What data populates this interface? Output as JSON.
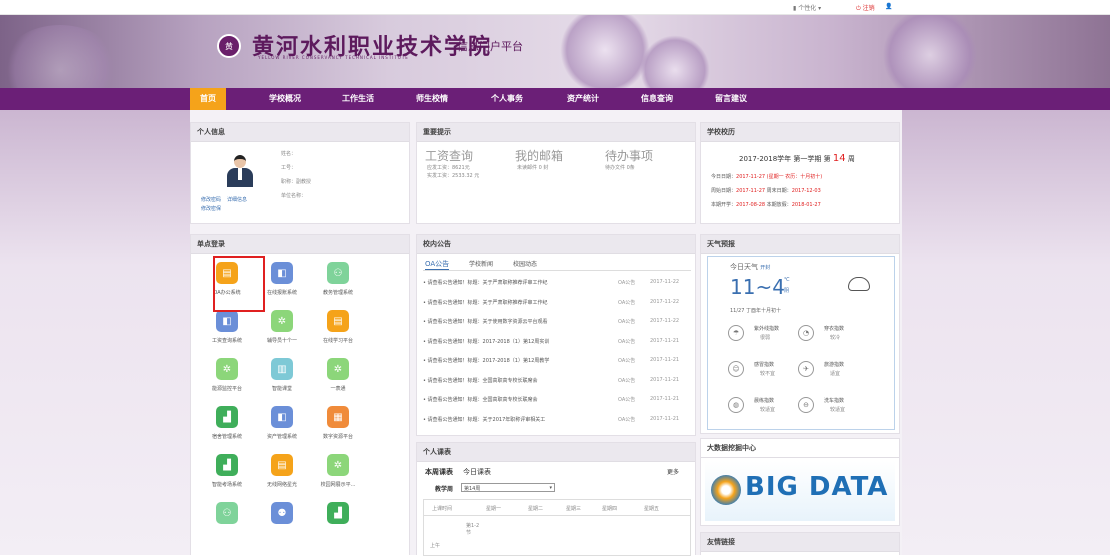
{
  "topbar": {
    "personal": "▮ 个性化 ▾",
    "logout": "⏻ 注销"
  },
  "header": {
    "logo_text": "黄",
    "school_name": "黄河水利职业技术学院",
    "portal_title": "信息门户平台",
    "english_name": "YELLOW RIVER CONSERVANCY TECHNICAL INSTITUTE"
  },
  "nav": [
    "首页",
    "学校概况",
    "工作生活",
    "师生校情",
    "个人事务",
    "资产统计",
    "信息查询",
    "留言建议"
  ],
  "profile": {
    "title": "个人信息",
    "fields": [
      "姓名：",
      "工号：",
      "职称：副教授",
      "单位名称："
    ],
    "links": [
      "修改密码",
      "详细信息",
      "修改密保"
    ]
  },
  "notice": {
    "title": "重要提示",
    "items": [
      {
        "head": "工资查询",
        "l1": "应发工资：8621元",
        "l2": "实发工资：2533.32 元"
      },
      {
        "head": "我的邮箱",
        "l1": "未读邮件 0 封",
        "l2": ""
      },
      {
        "head": "待办事项",
        "l1": "待办文件  0条",
        "l2": ""
      }
    ]
  },
  "calendar": {
    "title": "学校校历",
    "term": "2017-2018学年 第一学期 第",
    "week": "14",
    "week_unit": "周",
    "today_label": "今日日期：",
    "today": "2017-11-27 (星期一  农历：十月初十)",
    "ws_label": "周始日期：",
    "ws": "2017-11-27",
    "we_label": "周末日期：",
    "we": "2017-12-03",
    "ts_label": "本期开学：",
    "ts": "2017-08-28",
    "te_label": "本期放假：",
    "te": "2018-01-27"
  },
  "sso": {
    "title": "单点登录",
    "apps": [
      "OA办公系统",
      "在线报账系统",
      "教务管理系统",
      "工资查询系统",
      "辅导员十个一",
      "在线学习平台",
      "能源监控平台",
      "智能课堂",
      "一表通",
      "宿舍管理系统",
      "资产管理系统",
      "数字资源平台",
      "智能考场系统",
      "无线网络星光",
      "校园网展示平...",
      "",
      ""
    ]
  },
  "news": {
    "title": "校内公告",
    "tabs": [
      "OA公告",
      "学校新闻",
      "校园动态"
    ],
    "rows": [
      {
        "t": "• 请查看公告通知！标题：关于严肃职称推荐评审工作纪",
        "s": "OA公告",
        "d": "2017-11-22"
      },
      {
        "t": "• 请查看公告通知！标题：关于严肃职称推荐评审工作纪",
        "s": "OA公告",
        "d": "2017-11-22"
      },
      {
        "t": "• 请查看公告通知！标题：关于使用数字资源云平台观看",
        "s": "OA公告",
        "d": "2017-11-22"
      },
      {
        "t": "• 请查看公告通知！标题：2017-2018（1）第12周实训",
        "s": "OA公告",
        "d": "2017-11-21"
      },
      {
        "t": "• 请查看公告通知！标题：2017-2018（1）第12周教学",
        "s": "OA公告",
        "d": "2017-11-21"
      },
      {
        "t": "• 请查看公告通知！标题：全国高职高专校长联席会",
        "s": "OA公告",
        "d": "2017-11-21"
      },
      {
        "t": "• 请查看公告通知！标题：全国高职高专校长联席会",
        "s": "OA公告",
        "d": "2017-11-21"
      },
      {
        "t": "• 请查看公告通知！标题：关于2017年职称评审相关工",
        "s": "OA公告",
        "d": "2017-11-21"
      }
    ]
  },
  "weather": {
    "title": "天气预报",
    "today": "今日天气",
    "today_link": "开封",
    "temp": "11~4",
    "unit": "℃",
    "cond": "阴",
    "date": "11/27 丁酉年十月初十",
    "items": [
      {
        "n": "紫外线指数",
        "v": "很弱"
      },
      {
        "n": "穿衣指数",
        "v": "较冷"
      },
      {
        "n": "感冒指数",
        "v": "较不宜"
      },
      {
        "n": "旅游指数",
        "v": "适宜"
      },
      {
        "n": "晨练指数",
        "v": "较适宜"
      },
      {
        "n": "洗车指数",
        "v": "较适宜"
      }
    ]
  },
  "schedule": {
    "title": "个人课表",
    "tabs": [
      "本周课表",
      "今日课表"
    ],
    "more": "更多",
    "week_label": "教学周",
    "week_value": "第14周",
    "cols": [
      "上课时间",
      "星期一",
      "星期二",
      "星期三",
      "星期四",
      "星期五"
    ],
    "row1": "第1-2节",
    "am": "上午"
  },
  "bigdata": {
    "title": "大数据挖掘中心",
    "banner": "BIG DATA"
  },
  "links": {
    "title": "友情链接"
  },
  "colors": {
    "nav": "#6b1f77",
    "nav_active": "#f5a31a",
    "accent": "#e02020"
  }
}
